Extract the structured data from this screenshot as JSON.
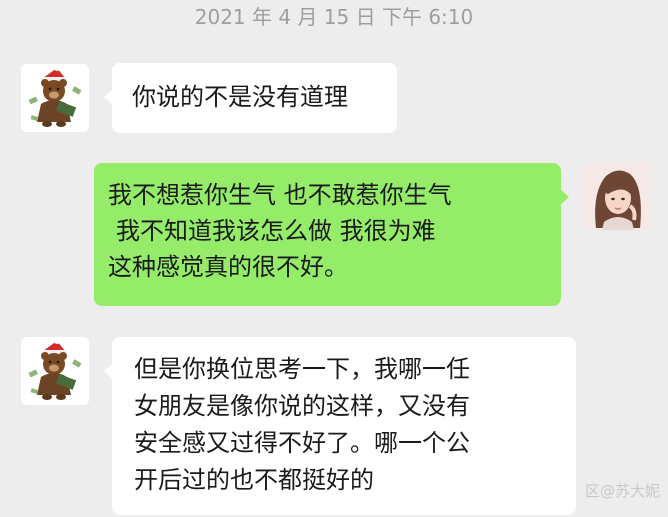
{
  "chat": {
    "timestamp": "2021 年 4 月 15 日 下午 6:10",
    "messages": [
      {
        "side": "left",
        "avatar_icon": "brown-bear-santa-hat-avatar-icon",
        "lines": [
          "你说的不是没有道理"
        ]
      },
      {
        "side": "right",
        "avatar_icon": "girl-portrait-avatar-icon",
        "lines": [
          "我不想惹你生气 也不敢惹你生气",
          "我不知道我该怎么做 我很为难",
          "这种感觉真的很不好。"
        ]
      },
      {
        "side": "left",
        "avatar_icon": "brown-bear-santa-hat-avatar-icon",
        "lines": [
          "但是你换位思考一下，我哪一任",
          "女朋友是像你说的这样，又没有",
          "安全感又过得不好了。哪一个公",
          "开后过的也不都挺好的"
        ]
      }
    ]
  },
  "watermark": "区@苏大妮",
  "colors": {
    "background": "#ededed",
    "bubble_self": "#95ec69",
    "bubble_other": "#ffffff",
    "timestamp": "#9e9e9e"
  }
}
